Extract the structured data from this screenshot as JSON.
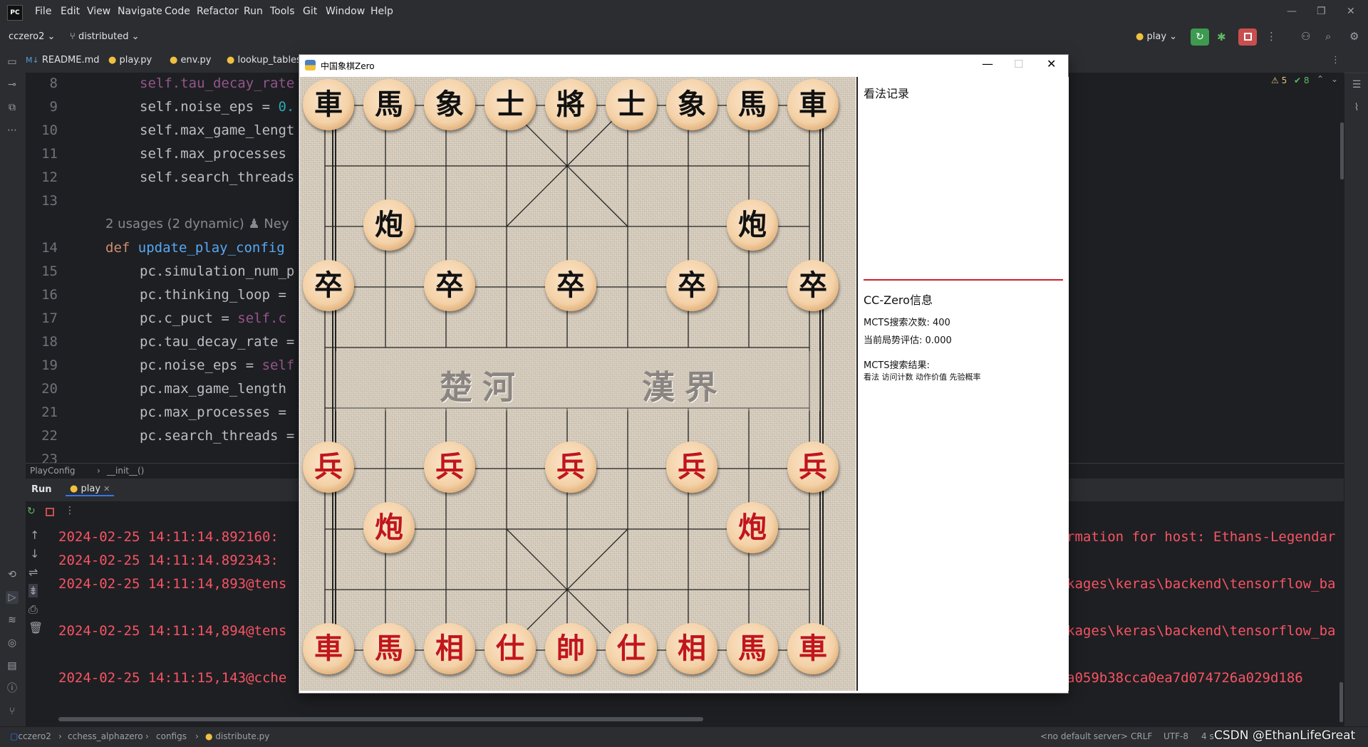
{
  "ide": {
    "app_icon": "PC",
    "menu": [
      "File",
      "Edit",
      "View",
      "Navigate",
      "Code",
      "Refactor",
      "Run",
      "Tools",
      "Git",
      "Window",
      "Help"
    ],
    "project": "cczero2",
    "branch": "distributed",
    "run_config": "play",
    "tabs": [
      "README.md",
      "play.py",
      "env.py",
      "lookup_tables."
    ],
    "inspections": {
      "warnings": "5",
      "ok": "8"
    },
    "line_numbers": [
      "8",
      "9",
      "10",
      "11",
      "12",
      "13",
      "",
      "14",
      "15",
      "16",
      "17",
      "18",
      "19",
      "20",
      "21",
      "22",
      "23"
    ],
    "code": {
      "l8": "self.tau_decay_rate",
      "l9a": "self.noise_eps = ",
      "l9b": "0.",
      "l10": "self.max_game_lengt",
      "l11": "self.max_processes",
      "l12": "self.search_threads",
      "hint": "2 usages (2 dynamic)   ♟ Ney",
      "l14a": "def ",
      "l14b": "update_play_config",
      "l15": "pc.simulation_num_p",
      "l16": "pc.thinking_loop = ",
      "l17a": "pc.c_puct = ",
      "l17b": "self.c",
      "l18": "pc.tau_decay_rate = ",
      "l19a": "pc.noise_eps = ",
      "l19b": "self",
      "l20": "pc.max_game_length ",
      "l21": "pc.max_processes = ",
      "l22": "pc.search_threads = "
    },
    "breadcrumb": [
      "PlayConfig",
      "__init__()"
    ],
    "run_tab": "Run",
    "run_subtab": "play",
    "logs": [
      "2024-02-25 14:11:14.892160: ",
      "2024-02-25 14:11:14.892343: ",
      "2024-02-25 14:11:14,893@tens",
      "2024-02-25 14:11:14,894@tens",
      "2024-02-25 14:11:15,143@cche"
    ],
    "logs_right": [
      "rmation for host: Ethans-Legendar",
      "kages\\keras\\backend\\tensorflow_ba",
      "kages\\keras\\backend\\tensorflow_ba",
      "a059b38cca0ea7d074726a029d186"
    ],
    "status_path": [
      "cczero2",
      "cchess_alphazero",
      "configs",
      "distribute.py"
    ],
    "status_right": [
      "<no default server>",
      "CRLF",
      "UTF-8",
      "4 s"
    ],
    "watermark": "CSDN @EthanLifeGreat"
  },
  "chess_window": {
    "title": "中国象棋Zero",
    "river_left": "楚河",
    "river_right": "漢界",
    "black_back_rank": [
      "車",
      "馬",
      "象",
      "士",
      "將",
      "士",
      "象",
      "馬",
      "車"
    ],
    "black_cannon": "炮",
    "black_pawn": "卒",
    "red_back_rank": [
      "車",
      "馬",
      "相",
      "仕",
      "帥",
      "仕",
      "相",
      "馬",
      "車"
    ],
    "red_cannon": "炮",
    "red_pawn": "兵",
    "info": {
      "move_record_title": "看法记录",
      "cc_title": "CC-Zero信息",
      "mcts_count_label": "MCTS搜索次数:",
      "mcts_count": "400",
      "eval_label": "当前局势评估:",
      "eval_value": "0.000",
      "mcts_result_label": "MCTS搜索结果:",
      "mcts_columns": "看法 访问计数 动作价值 先验概率"
    },
    "colors": {
      "divider": "#d11f2a",
      "red_piece": "#c0161c",
      "black_piece": "#111111"
    }
  }
}
